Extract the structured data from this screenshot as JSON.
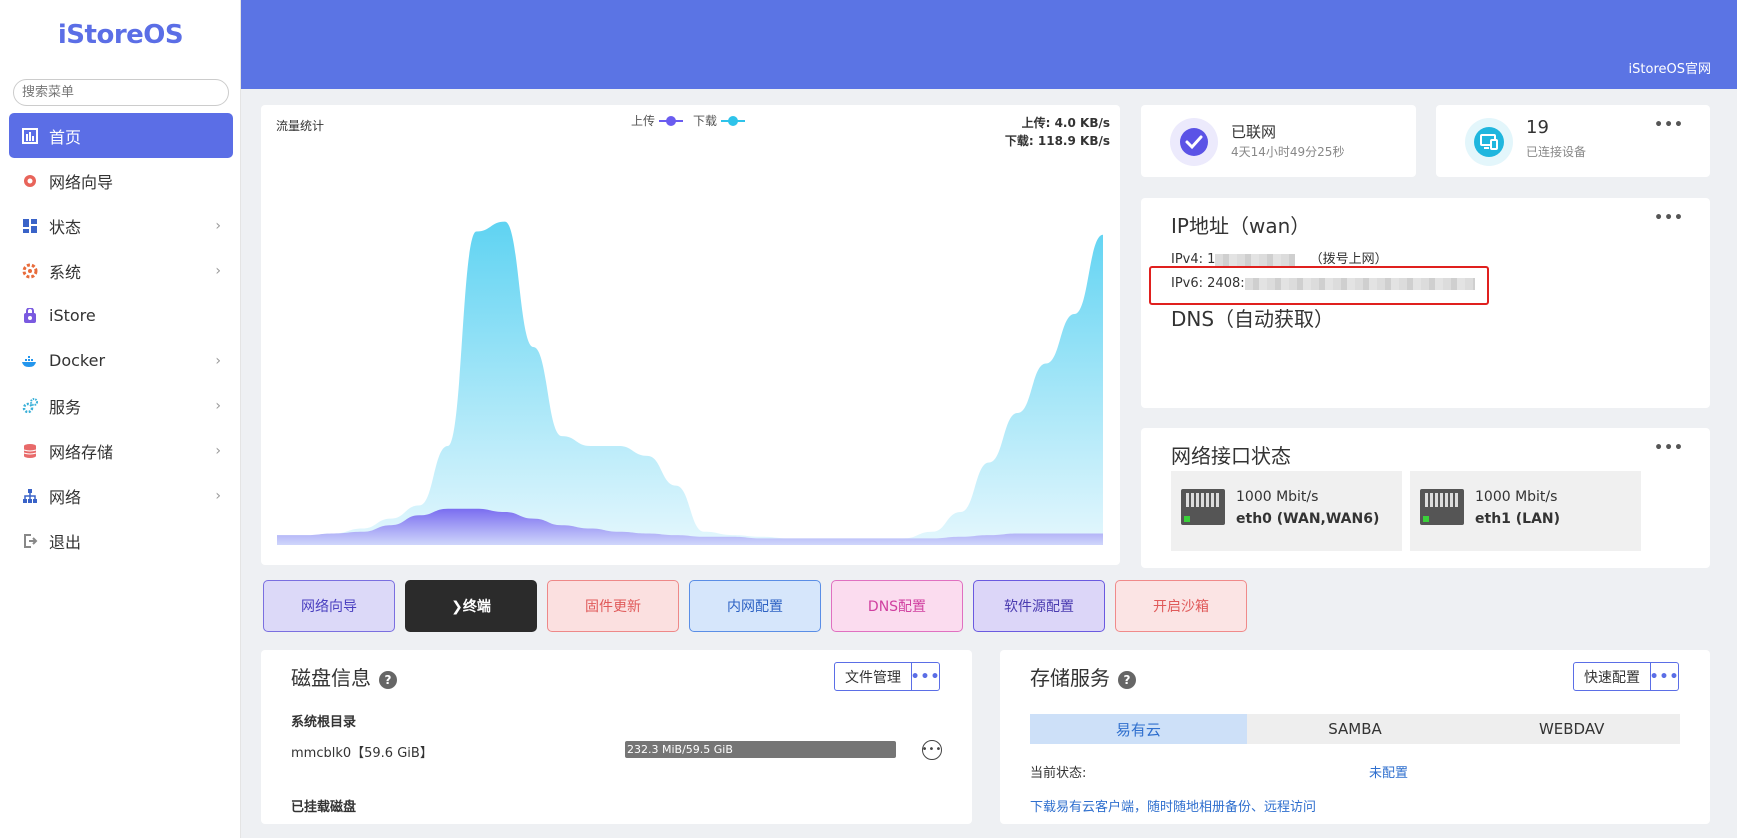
{
  "sidebar": {
    "logo": "iStoreOS",
    "search_placeholder": "搜索菜单",
    "items": [
      {
        "label": "首页",
        "active": true,
        "icon": "home-icon",
        "has_arrow": false
      },
      {
        "label": "网络向导",
        "active": false,
        "icon": "wizard-icon",
        "has_arrow": false
      },
      {
        "label": "状态",
        "active": false,
        "icon": "status-icon",
        "has_arrow": true
      },
      {
        "label": "系统",
        "active": false,
        "icon": "system-gear-icon",
        "has_arrow": true
      },
      {
        "label": "iStore",
        "active": false,
        "icon": "store-bag-icon",
        "has_arrow": false
      },
      {
        "label": "Docker",
        "active": false,
        "icon": "docker-icon",
        "has_arrow": true
      },
      {
        "label": "服务",
        "active": false,
        "icon": "services-icon",
        "has_arrow": true
      },
      {
        "label": "网络存储",
        "active": false,
        "icon": "storage-icon",
        "has_arrow": true
      },
      {
        "label": "网络",
        "active": false,
        "icon": "network-icon",
        "has_arrow": true
      },
      {
        "label": "退出",
        "active": false,
        "icon": "logout-icon",
        "has_arrow": false
      }
    ]
  },
  "header": {
    "link": "iStoreOS官网"
  },
  "traffic": {
    "title": "流量统计",
    "legend_upload": "上传",
    "legend_download": "下载",
    "upload_speed": "上传: 4.0 KB/s",
    "download_speed": "下载: 118.9 KB/s",
    "colors": {
      "upload": "#6a5cf0",
      "download": "#2ec3ea"
    }
  },
  "chart_data": {
    "type": "area",
    "series": [
      {
        "name": "上传",
        "values": [
          0.03,
          0.03,
          0.035,
          0.04,
          0.06,
          0.09,
          0.11,
          0.11,
          0.1,
          0.08,
          0.06,
          0.05,
          0.04,
          0.035,
          0.03,
          0.025,
          0.025,
          0.02,
          0.02,
          0.02,
          0.02,
          0.02,
          0.02,
          0.02,
          0.025,
          0.03,
          0.035,
          0.035,
          0.035,
          0.035
        ]
      },
      {
        "name": "下载",
        "values": [
          0.03,
          0.03,
          0.035,
          0.05,
          0.08,
          0.12,
          0.3,
          0.95,
          0.98,
          0.6,
          0.33,
          0.3,
          0.3,
          0.27,
          0.18,
          0.04,
          0.03,
          0.025,
          0.02,
          0.02,
          0.02,
          0.02,
          0.02,
          0.04,
          0.1,
          0.25,
          0.4,
          0.55,
          0.7,
          0.94
        ]
      }
    ],
    "ylim": [
      0,
      1
    ],
    "grid": false,
    "legend_position": "top-center"
  },
  "status_cards": {
    "net": {
      "title": "已联网",
      "sub": "4天14小时49分25秒"
    },
    "devices": {
      "count": "19",
      "sub": "已连接设备"
    }
  },
  "ip_card": {
    "title": "IP地址（wan）",
    "ipv4_prefix": "IPv4: 1",
    "ipv4_note": "（拨号上网）",
    "ipv6_prefix": "IPv6: 2408:",
    "dns_title": "DNS（自动获取）"
  },
  "interfaces": {
    "title": "网络接口状态",
    "ports": [
      {
        "speed": "1000 Mbit/s",
        "name": "eth0 (WAN,WAN6)"
      },
      {
        "speed": "1000 Mbit/s",
        "name": "eth1 (LAN)"
      }
    ]
  },
  "quick_buttons": [
    {
      "label": "网络向导",
      "bg": "#dcd9f8",
      "border": "#7a6fe0",
      "color": "#4a3fc0"
    },
    {
      "label": "❯终端",
      "bg": "#2b2b2b",
      "border": "#2b2b2b",
      "color": "#ffffff"
    },
    {
      "label": "固件更新",
      "bg": "#fbe0e0",
      "border": "#e88",
      "color": "#e05a5a"
    },
    {
      "label": "内网配置",
      "bg": "#d6e6fb",
      "border": "#5a8ee6",
      "color": "#2e63c4"
    },
    {
      "label": "DNS配置",
      "bg": "#fbdcef",
      "border": "#e070c0",
      "color": "#d040a0"
    },
    {
      "label": "软件源配置",
      "bg": "#dcd6f8",
      "border": "#6a5ae0",
      "color": "#4a3bb0"
    },
    {
      "label": "开启沙箱",
      "bg": "#fbe4e4",
      "border": "#f08a8a",
      "color": "#e05a5a"
    }
  ],
  "disk": {
    "title": "磁盘信息",
    "file_btn": "文件管理",
    "root_label": "系统根目录",
    "device": "mmcblk0【59.6 GiB】",
    "usage_text": "232.3 MiB/59.5 GiB",
    "usage_fraction": 0.004,
    "mounted_label": "已挂载磁盘"
  },
  "storage": {
    "title": "存储服务",
    "config_btn": "快速配置",
    "tabs": [
      "易有云",
      "SAMBA",
      "WEBDAV"
    ],
    "status_label": "当前状态:",
    "status_value": "未配置",
    "download_link": "下载易有云客户端，随时随地相册备份、远程访问"
  }
}
